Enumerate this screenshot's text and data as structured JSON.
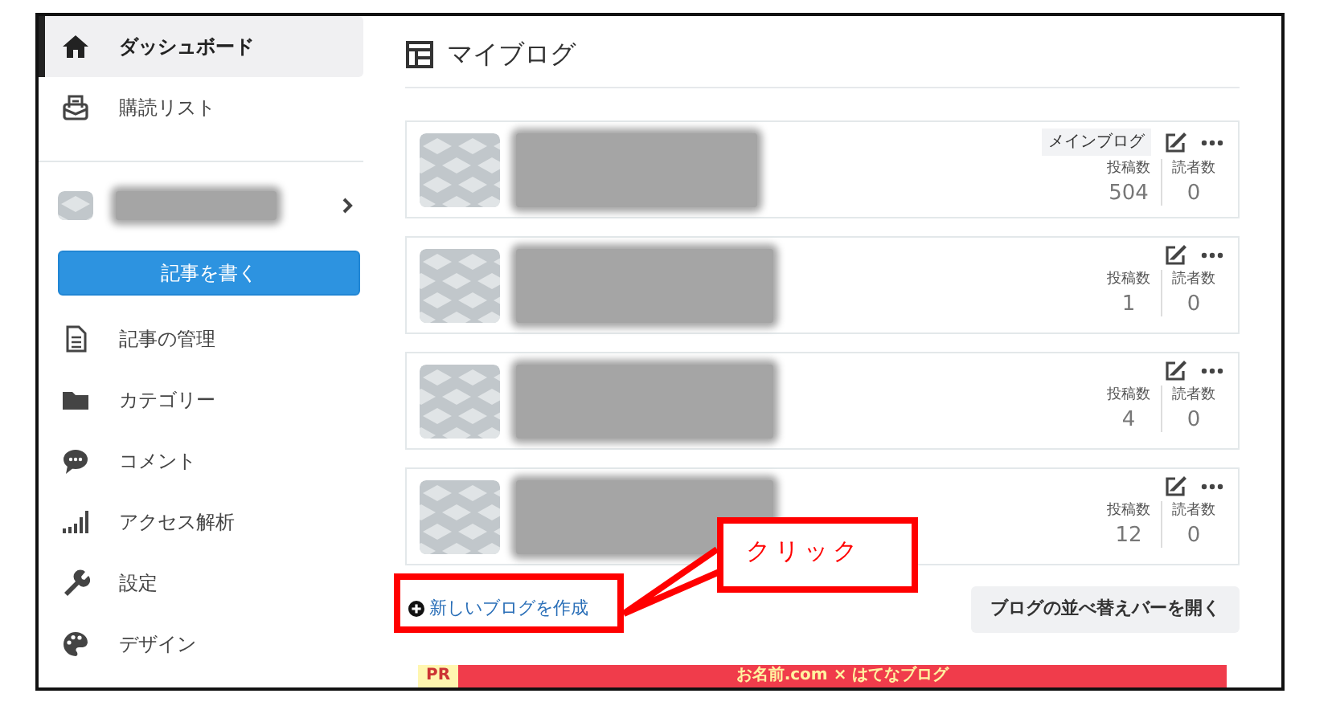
{
  "sidebar": {
    "items": [
      {
        "kind": "nav",
        "label": "ダッシュボード",
        "selected": true
      },
      {
        "kind": "nav",
        "label": "購読リスト",
        "selected": false
      },
      {
        "kind": "account"
      },
      {
        "kind": "write",
        "label": "記事を書く"
      },
      {
        "kind": "nav",
        "label": "記事の管理",
        "selected": false
      },
      {
        "kind": "nav",
        "label": "カテゴリー",
        "selected": false
      },
      {
        "kind": "nav",
        "label": "コメント",
        "selected": false
      },
      {
        "kind": "nav",
        "label": "アクセス解析",
        "selected": false
      },
      {
        "kind": "nav",
        "label": "設定",
        "selected": false
      },
      {
        "kind": "nav",
        "label": "デザイン",
        "selected": false
      }
    ]
  },
  "main": {
    "title": "マイブログ",
    "blogs": [
      {
        "badge": "メインブログ",
        "stats": [
          {
            "label": "投稿数",
            "value": "504"
          },
          {
            "label": "読者数",
            "value": "0"
          }
        ]
      },
      {
        "stats": [
          {
            "label": "投稿数",
            "value": "1"
          },
          {
            "label": "読者数",
            "value": "0"
          }
        ]
      },
      {
        "stats": [
          {
            "label": "投稿数",
            "value": "4"
          },
          {
            "label": "読者数",
            "value": "0"
          }
        ]
      },
      {
        "stats": [
          {
            "label": "投稿数",
            "value": "12"
          },
          {
            "label": "読者数",
            "value": "0"
          }
        ]
      }
    ],
    "create_link": "新しいブログを作成",
    "sort_button": "ブログの並べ替えバーを開く",
    "banner": {
      "tag": "PR",
      "text": "お名前.com × はてなブログ"
    }
  },
  "annotation": {
    "callout": "クリック"
  }
}
